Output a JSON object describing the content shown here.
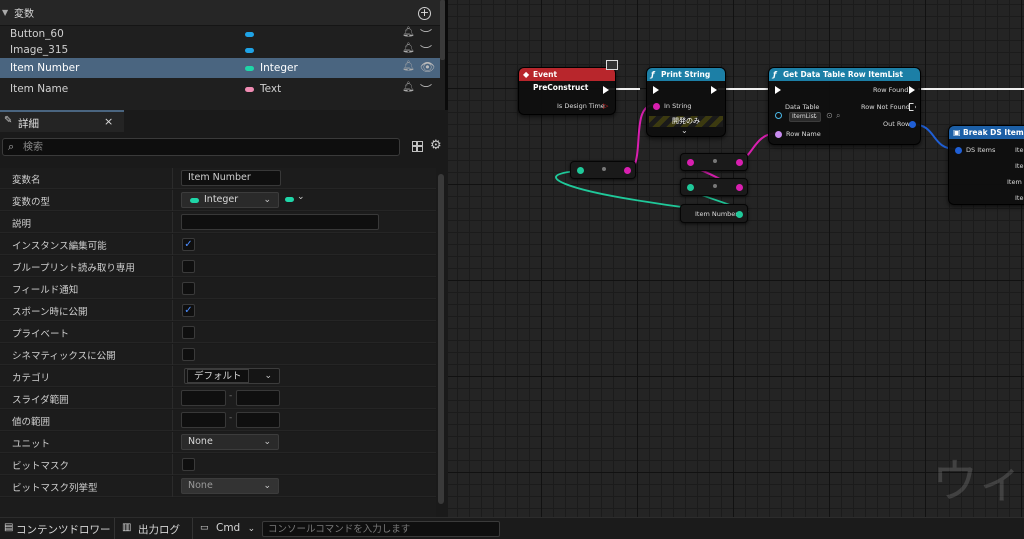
{
  "variables": {
    "header": "変数",
    "items": [
      {
        "name": "Button_60",
        "pill_color": "#1fa3e6",
        "type": ""
      },
      {
        "name": "Image_315",
        "pill_color": "#1fa3e6",
        "type": ""
      },
      {
        "name": "Item Number",
        "pill_color": "#1fd6a8",
        "type": "Integer"
      },
      {
        "name": "Item Name",
        "pill_color": "#f08cb3",
        "type": "Text"
      }
    ]
  },
  "details": {
    "tab_title": "詳細",
    "search_placeholder": "検索",
    "properties": [
      {
        "label": "変数名",
        "value": "Item Number"
      },
      {
        "label": "変数の型",
        "value": "Integer"
      },
      {
        "label": "説明",
        "value": ""
      },
      {
        "label": "インスタンス編集可能",
        "checked": true
      },
      {
        "label": "ブループリント読み取り専用",
        "checked": false
      },
      {
        "label": "フィールド通知",
        "checked": false
      },
      {
        "label": "スポーン時に公開",
        "checked": true
      },
      {
        "label": "プライベート",
        "checked": false
      },
      {
        "label": "シネマティックスに公開",
        "checked": false
      },
      {
        "label": "カテゴリ",
        "value": "デフォルト"
      },
      {
        "label": "スライダ範囲",
        "value": ""
      },
      {
        "label": "値の範囲",
        "value": ""
      },
      {
        "label": "ユニット",
        "value": "None"
      },
      {
        "label": "ビットマスク",
        "checked": false
      },
      {
        "label": "ビットマスク列挙型",
        "value": "None"
      }
    ],
    "range_separator": "-"
  },
  "bottom_bar": {
    "content_drawer": "コンテンツドロワー",
    "output_log": "出力ログ",
    "cmd": "Cmd",
    "console_placeholder": "コンソールコマンドを入力します"
  },
  "graph": {
    "event_node": {
      "title": "Event PreConstruct",
      "pin": "Is Design Time",
      "color": "#b8262c"
    },
    "print_node": {
      "title": "Print String",
      "pin": "In String",
      "dev_only": "開発のみ",
      "color": "#1c7fa6"
    },
    "datatable_node": {
      "title": "Get Data Table Row ItemList",
      "data_table_label": "Data Table",
      "data_table_value": "ItemList",
      "row_name": "Row Name",
      "row_found": "Row Found",
      "row_not_found": "Row Not Found",
      "out_row": "Out Row",
      "color": "#1c7fa6"
    },
    "break_node": {
      "title": "Break DS Items",
      "pin": "DS Items",
      "out1": "Item N",
      "out2": "Item",
      "out3": "Item A",
      "out4": "Item",
      "color": "#1c5fa6"
    },
    "var_get": {
      "label": "Item Number"
    },
    "watermark": "ウィ"
  }
}
